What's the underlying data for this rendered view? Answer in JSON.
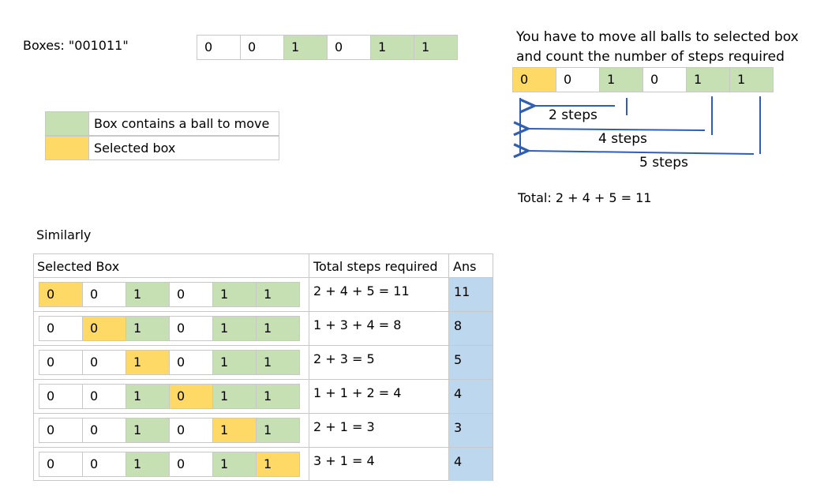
{
  "boxes_label": "Boxes: \"001011\"",
  "boxes": [
    "0",
    "0",
    "1",
    "0",
    "1",
    "1"
  ],
  "boxes_fill": [
    "w",
    "w",
    "g",
    "w",
    "g",
    "g"
  ],
  "explanation": {
    "line1": "You have to move all balls to selected box",
    "line2": "and count the number of steps required",
    "example_fill": [
      "y",
      "w",
      "g",
      "w",
      "g",
      "g"
    ],
    "arrow1_label": "2 steps",
    "arrow2_label": "4 steps",
    "arrow3_label": "5 steps",
    "total": "Total: 2 + 4 + 5 = 11"
  },
  "legend": [
    {
      "fill": "g",
      "label": "Box contains a ball to move"
    },
    {
      "fill": "y",
      "label": "Selected box"
    }
  ],
  "similarly": "Similarly",
  "table": {
    "header_selected": "Selected Box",
    "header_steps": "Total steps required",
    "header_ans": "Ans",
    "rows": [
      {
        "selected": 0,
        "steps": "2 + 4 + 5 = 11",
        "ans": "11"
      },
      {
        "selected": 1,
        "steps": "1 + 3 + 4 = 8",
        "ans": "8"
      },
      {
        "selected": 2,
        "steps": "2 + 3 = 5",
        "ans": "5"
      },
      {
        "selected": 3,
        "steps": "1 + 1 + 2 = 4",
        "ans": "4"
      },
      {
        "selected": 4,
        "steps": "2 + 1 = 3",
        "ans": "3"
      },
      {
        "selected": 5,
        "steps": "3 + 1 = 4",
        "ans": "4"
      }
    ]
  },
  "colors": {
    "green": "#c6e0b4",
    "yellow": "#ffd966",
    "blue": "#bdd7ee",
    "arrow": "#2f5fb3"
  }
}
